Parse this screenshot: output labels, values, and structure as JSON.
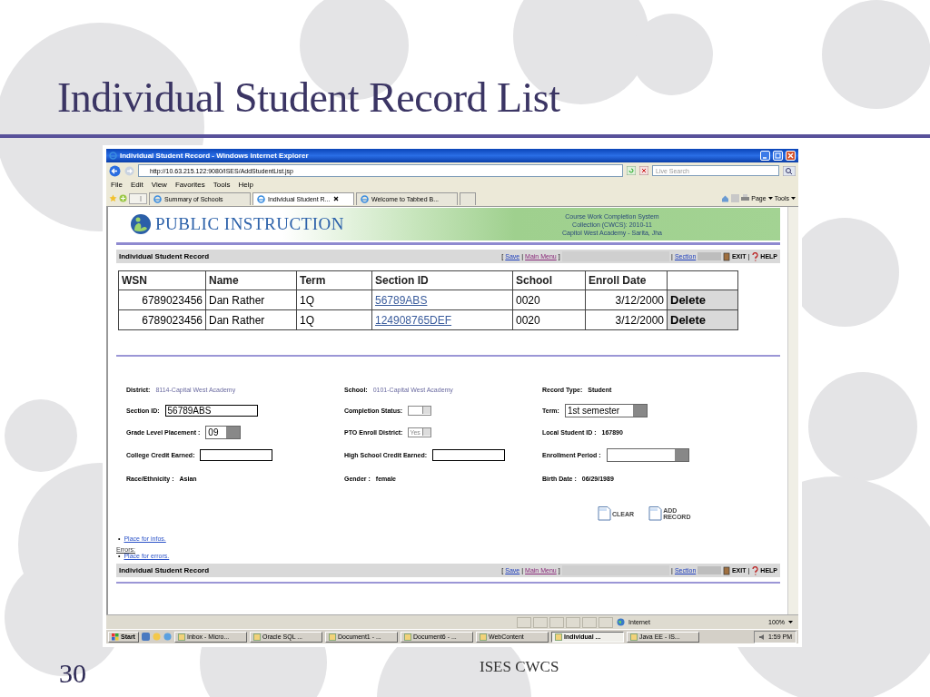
{
  "slide": {
    "title": "Individual Student Record List",
    "page_number": "30",
    "footer": "ISES CWCS"
  },
  "window": {
    "title": "Individual Student Record - Windows Internet Explorer",
    "address": "http://10.63.215.122:9080/ISES/AddStudentList.jsp",
    "search": {
      "placeholder": "Live Search"
    },
    "menu": [
      "File",
      "Edit",
      "View",
      "Favorites",
      "Tools",
      "Help"
    ],
    "tabs": [
      {
        "label": "Summary of Schools",
        "selected": false
      },
      {
        "label": "Individual Student R...",
        "selected": true
      },
      {
        "label": "Welcome to Tabbed B...",
        "selected": false
      }
    ],
    "toolbar": [
      "Page",
      "Tools"
    ]
  },
  "page": {
    "logo": "PUBLIC INSTRUCTION",
    "system_info": [
      "Course Work Completion System",
      "Collection (CWCS): 2010-11",
      "Capitol West Academy - Sarita, Jha"
    ],
    "top_bar": {
      "title": "Individual Student Record",
      "open": "[",
      "links": [
        "Save",
        "Main Menu"
      ],
      "separator": "|",
      "close": "]",
      "section": "Section",
      "actions": [
        "EXIT",
        "HELP"
      ]
    },
    "table": {
      "columns": [
        "WSN",
        "Name",
        "Term",
        "Section ID",
        "School",
        "Enroll Date"
      ],
      "rows": [
        {
          "wsn": "6789023456",
          "name": "Dan Rather",
          "term": "1Q",
          "section_id": "56789ABS",
          "school": "0020",
          "enroll_date": "3/12/2000",
          "action": "Delete"
        },
        {
          "wsn": "6789023456",
          "name": "Dan Rather",
          "term": "1Q",
          "section_id": "124908765DEF",
          "school": "0020",
          "enroll_date": "3/12/2000",
          "action": "Delete"
        }
      ]
    },
    "form": {
      "columns": [
        [
          {
            "kind": "info",
            "label": "District:",
            "value": "8114-Capital West Academy"
          },
          {
            "kind": "input",
            "label": "Section ID:",
            "value": "56789ABS"
          },
          {
            "kind": "combo",
            "label": "Grade Level Placement :",
            "value": "09"
          },
          {
            "kind": "input",
            "label": "College Credit Earned:"
          },
          {
            "kind": "text",
            "label": "Race/Ethnicity :",
            "value": "Asian"
          }
        ],
        [
          {
            "kind": "info",
            "label": "School:",
            "value": "0101-Capital West Academy"
          },
          {
            "kind": "select",
            "label": "Completion Status:"
          },
          {
            "kind": "select",
            "label": "PTO Enroll District:",
            "value": "Yes"
          },
          {
            "kind": "input",
            "label": "High School Credit Earned:"
          },
          {
            "kind": "text",
            "label": "Gender :",
            "value": "female"
          }
        ],
        [
          {
            "kind": "text",
            "label": "Record Type:",
            "value": "Student"
          },
          {
            "kind": "combo",
            "label": "Term:",
            "value": "1st semester"
          },
          {
            "kind": "text",
            "label": "Local Student ID :",
            "value": "167890"
          },
          {
            "kind": "combo",
            "label": "Enrollment Period :"
          },
          {
            "kind": "text",
            "label": "Birth Date :",
            "value": "06/29/1989"
          }
        ]
      ]
    },
    "buttons": [
      "CLEAR",
      "ADD RECORD"
    ],
    "bullet": "•",
    "infos": [
      "Place for infos."
    ],
    "errors_label": "Errors:",
    "errors": [
      "Place for errors."
    ],
    "bottom_bar": {
      "title": "Individual Student Record",
      "open": "[",
      "links": [
        "Save",
        "Main Menu"
      ],
      "separator": "|",
      "close": "]",
      "section": "Section",
      "actions": [
        "EXIT",
        "HELP"
      ]
    }
  },
  "status_bar": {
    "zone": "Internet",
    "zoom": "100%"
  },
  "taskbar": {
    "start": "Start",
    "items": [
      {
        "label": "Inbox - Micro...",
        "selected": false
      },
      {
        "label": "Oracle SQL ...",
        "selected": false
      },
      {
        "label": "Document1 - ...",
        "selected": false
      },
      {
        "label": "Document6 - ...",
        "selected": false
      },
      {
        "label": "WebContent",
        "selected": false
      },
      {
        "label": "Individual ...",
        "selected": true
      },
      {
        "label": "Java EE - IS...",
        "selected": false
      }
    ],
    "clock": "1:59 PM"
  }
}
